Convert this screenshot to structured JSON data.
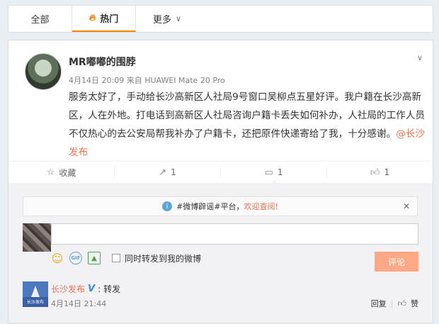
{
  "tabs": [
    {
      "label": "全部"
    },
    {
      "label": "热门"
    },
    {
      "label": "更多"
    }
  ],
  "post": {
    "username": "MR嘟嘟的围脖",
    "time": "4月14日 20:09",
    "source": "来自 HUAWEI Mate 20 Pro",
    "text": "服务太好了，手动给长沙高新区人社局9号窗口吴柳点五星好评。我户籍在长沙高新区，人在外地。打电话到高新区人社局咨询户籍卡丢失如何补办，人社局的工作人员不仅热心的去公安局帮我补办了户籍卡，还把原件快递寄给了我，十分感谢。",
    "mention": "@长沙发布"
  },
  "actions": {
    "favorite": "收藏",
    "repost_count": "1",
    "comment_count": "1",
    "like_count": "1"
  },
  "comments": {
    "notice_prefix": "#微博辟谣#平台，",
    "notice_highlight": "欢迎查阅!",
    "input_value": "",
    "repost_label": "同时转发到我的微博",
    "submit_label": "评论",
    "list": [
      {
        "name": "长沙发布",
        "avatar_text": "长沙发布",
        "text": "转发",
        "time": "4月14日 21:44",
        "reply_label": "回复",
        "like_label": "赞"
      }
    ]
  }
}
